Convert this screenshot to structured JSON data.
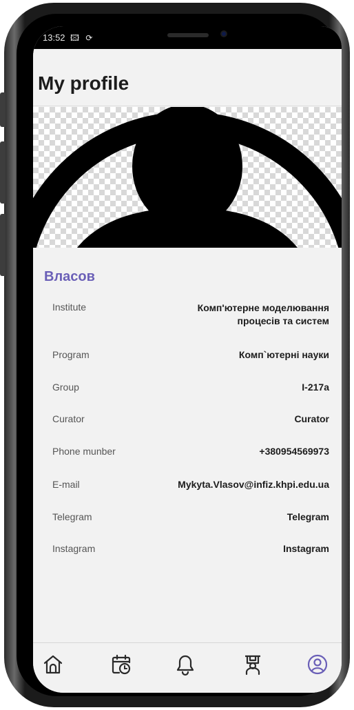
{
  "status_bar": {
    "time": "13:52",
    "icons": "🖾 ⟳"
  },
  "header": {
    "title": "My profile"
  },
  "profile": {
    "surname": "Власов",
    "fields": [
      {
        "label": "Institute",
        "value": "Комп'ютерне моделювання процесів та систем"
      },
      {
        "label": "Program",
        "value": "Комп`ютерні науки"
      },
      {
        "label": "Group",
        "value": "І-217а"
      },
      {
        "label": "Curator",
        "value": "Curator"
      },
      {
        "label": "Phone munber",
        "value": "+380954569973"
      },
      {
        "label": "E-mail",
        "value": "Mykyta.Vlasov@infiz.khpi.edu.ua"
      },
      {
        "label": "Telegram",
        "value": "Telegram"
      },
      {
        "label": "Instagram",
        "value": "Instagram"
      }
    ]
  },
  "bottom_nav": {
    "items": [
      {
        "icon": "home-icon",
        "active": false
      },
      {
        "icon": "calendar-clock-icon",
        "active": false
      },
      {
        "icon": "bell-icon",
        "active": false
      },
      {
        "icon": "teacher-icon",
        "active": false
      },
      {
        "icon": "profile-icon",
        "active": true
      }
    ]
  },
  "colors": {
    "accent": "#6a5fb7",
    "inactive_icon": "#2a2a2a",
    "active_icon": "#6a5fb7"
  }
}
